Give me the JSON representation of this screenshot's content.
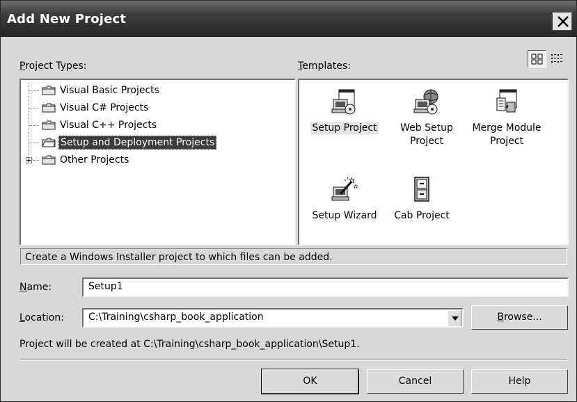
{
  "window": {
    "title": "Add New Project"
  },
  "labels": {
    "project_types_pre": "",
    "project_types_ul": "P",
    "project_types_post": "roject Types:",
    "templates_ul": "T",
    "templates_post": "emplates:",
    "name_ul": "N",
    "name_post": "ame:",
    "location_ul": "L",
    "location_post": "ocation:"
  },
  "project_types": [
    {
      "label": "Visual Basic Projects",
      "selected": false,
      "expandable": false
    },
    {
      "label": "Visual C# Projects",
      "selected": false,
      "expandable": false
    },
    {
      "label": "Visual C++ Projects",
      "selected": false,
      "expandable": false
    },
    {
      "label": "Setup and Deployment Projects",
      "selected": true,
      "expandable": false
    },
    {
      "label": "Other Projects",
      "selected": false,
      "expandable": true
    }
  ],
  "templates": [
    {
      "line1": "Setup Project",
      "line2": "",
      "icon": "setup-project-icon",
      "selected": true
    },
    {
      "line1": "Web Setup",
      "line2": "Project",
      "icon": "web-setup-project-icon",
      "selected": false
    },
    {
      "line1": "Merge Module",
      "line2": "Project",
      "icon": "merge-module-project-icon",
      "selected": false
    },
    {
      "line1": "Setup Wizard",
      "line2": "",
      "icon": "setup-wizard-icon",
      "selected": false
    },
    {
      "line1": "Cab Project",
      "line2": "",
      "icon": "cab-project-icon",
      "selected": false
    }
  ],
  "description": "Create a Windows Installer project to which files can be added.",
  "name_value": "Setup1",
  "location_value": "C:\\Training\\csharp_book_application",
  "browse": {
    "ul": "B",
    "post": "rowse..."
  },
  "created_at": "Project will be created at C:\\Training\\csharp_book_application\\Setup1.",
  "buttons": {
    "ok": "OK",
    "cancel": "Cancel",
    "help": "Help"
  },
  "colors": {
    "titlebar": "#262626",
    "selection": "#3c3c3c",
    "dialog": "#d8d8d8"
  }
}
